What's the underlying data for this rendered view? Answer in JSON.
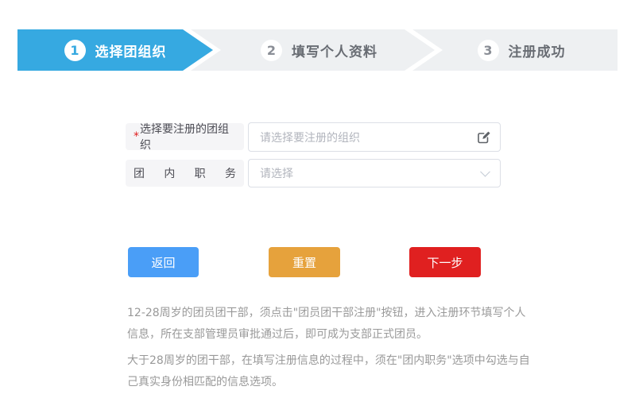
{
  "steps": [
    {
      "number": "1",
      "label": "选择团组织",
      "state": "active"
    },
    {
      "number": "2",
      "label": "填写个人资料",
      "state": "pending"
    },
    {
      "number": "3",
      "label": "注册成功",
      "state": "pending"
    }
  ],
  "form": {
    "org_required_mark": "*",
    "org_label": "选择要注册的团组织",
    "org_placeholder": "请选择要注册的组织",
    "position_label_chars": [
      "团",
      "内",
      "职",
      "务"
    ],
    "position_placeholder": "请选择"
  },
  "buttons": {
    "back": "返回",
    "reset": "重置",
    "next": "下一步"
  },
  "notes": [
    "12-28周岁的团员团干部，须点击\"团员团干部注册\"按钮，进入注册环节填写个人信息，所在支部管理员审批通过后，即可成为支部正式团员。",
    "大于28周岁的团干部，在填写注册信息的过程中，须在\"团内职务\"选项中勾选与自己真实身份相匹配的信息选项。"
  ],
  "colors": {
    "step_active": "#36a9e1",
    "step_inactive_bg": "#eef0f2",
    "button_back": "#4a9ef7",
    "button_reset": "#e6a23c",
    "button_next": "#e02020",
    "required_mark": "#e02020",
    "note_text": "#999999"
  }
}
